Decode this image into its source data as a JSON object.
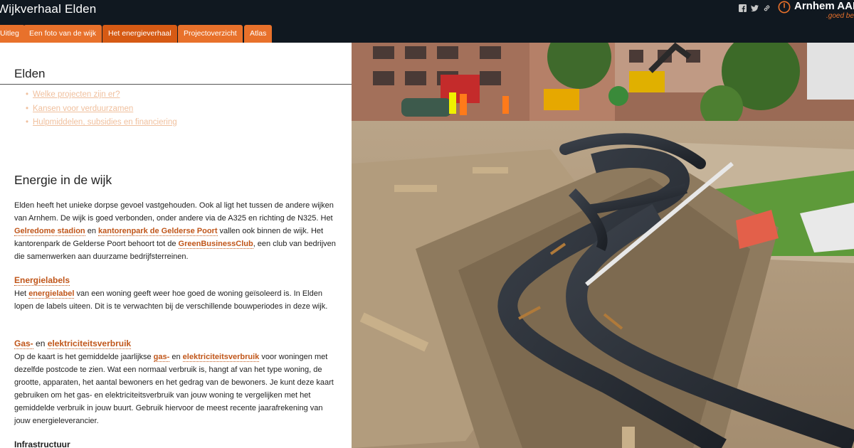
{
  "header": {
    "title": "Wijkverhaal Elden",
    "social_icons": [
      "facebook-icon",
      "twitter-icon",
      "link-icon"
    ],
    "logo": {
      "name": "Arnhem AAN",
      "tagline": ".goed bezig"
    },
    "tabs": [
      {
        "label": "Uitleg",
        "active": false
      },
      {
        "label": "Een foto van de wijk",
        "active": false
      },
      {
        "label": "Het energieverhaal",
        "active": true
      },
      {
        "label": "Projectoverzicht",
        "active": false
      },
      {
        "label": "Atlas",
        "active": false
      }
    ]
  },
  "content": {
    "page_title": "Elden",
    "toc": [
      "Welke projecten zijn er?",
      "Kansen voor verduurzamen",
      "Hulpmiddelen, subsidies en financiering"
    ],
    "section_title": "Energie in de wijk",
    "intro": {
      "t1": "Elden heeft het unieke dorpse gevoel vastgehouden. Ook al ligt het tussen de andere wijken van Arnhem. De wijk is goed verbonden, onder andere via de A325 en richting de N325. Het ",
      "l1": "Gelredome stadion",
      "t2": " en ",
      "l2": "kantorenpark de Gelderse Poort",
      "t3": " vallen ook binnen de wijk. Het kantorenpark de Gelderse Poort behoort tot de ",
      "l3": "GreenBusinessClub",
      "t4": ", een club van bedrijven die samenwerken aan duurzame bedrijfsterreinen."
    },
    "energielabels": {
      "heading": "Energielabels",
      "t1": "Het ",
      "l1": "energielabel",
      "t2": " van een woning geeft weer hoe goed de woning geïsoleerd is. In Elden lopen de labels uiteen. Dit is te verwachten bij de verschillende bouwperiodes in deze wijk."
    },
    "verbruik": {
      "heading_link1": "Gas-",
      "heading_mid": " en ",
      "heading_link2": "elektriciteitsverbruik",
      "t1": "Op de kaart is het gemiddelde jaarlijkse ",
      "l1": "gas-",
      "t2": " en ",
      "l2": "elektriciteitsverbruik",
      "t3": " voor woningen met dezelfde postcode te zien. Wat een normaal verbruik is, hangt af van het type woning, de grootte, apparaten, het aantal bewoners en het gedrag van de bewoners. Je kunt deze kaart gebruiken om het gas- en elektriciteitsverbruik van jouw woning te vergelijken met het gemiddelde verbruik in jouw buurt. Gebruik hiervoor de meest recente jaarafrekening van jouw energieleverancier."
    },
    "infra_heading": "Infrastructuur"
  },
  "colors": {
    "header_bg": "#101820",
    "accent": "#e8712b",
    "link": "#c0561a",
    "toc_link": "#f0c09e"
  }
}
